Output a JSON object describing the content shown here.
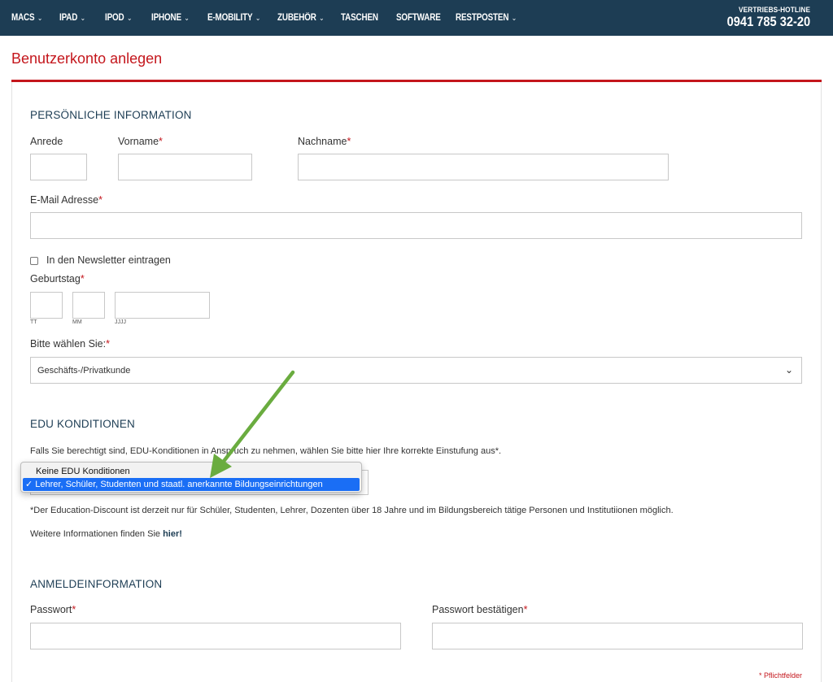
{
  "nav": {
    "items": [
      {
        "label": "MACS",
        "chevron": true
      },
      {
        "label": "IPAD",
        "chevron": true
      },
      {
        "label": "IPOD",
        "chevron": true
      },
      {
        "label": "IPHONE",
        "chevron": true
      },
      {
        "label": "E-MOBILITY",
        "chevron": true
      },
      {
        "label": "ZUBEHÖR",
        "chevron": true
      },
      {
        "label": "TASCHEN",
        "chevron": false
      },
      {
        "label": "SOFTWARE",
        "chevron": false
      },
      {
        "label": "RESTPOSTEN",
        "chevron": true
      }
    ],
    "hotline_label": "VERTRIEBS-HOTLINE",
    "hotline_number": "0941 785 32-20"
  },
  "page": {
    "title": "Benutzerkonto anlegen"
  },
  "personal": {
    "section_title": "PERSÖNLICHE INFORMATION",
    "salutation_label": "Anrede",
    "firstname_label": "Vorname",
    "lastname_label": "Nachname",
    "email_label": "E-Mail Adresse",
    "newsletter_label": "In den Newsletter eintragen",
    "birthday_label": "Geburtstag",
    "day_hint": "TT",
    "month_hint": "MM",
    "year_hint": "JJJJ",
    "customer_type_label": "Bitte wählen Sie:",
    "customer_type_value": "Geschäfts-/Privatkunde",
    "required_mark": "*"
  },
  "edu": {
    "section_title": "EDU KONDITIONEN",
    "intro_text": "Falls Sie berechtigt sind, EDU-Konditionen in Anspruch zu nehmen, wählen Sie bitte hier Ihre korrekte Einstufung aus*.",
    "options": [
      "Keine EDU Konditionen",
      "✓ Lehrer, Schüler, Studenten und staatl. anerkannte Bildungseinrichtungen"
    ],
    "disclaimer": "*Der Education-Discount ist derzeit nur für Schüler, Studenten, Lehrer, Dozenten über 18 Jahre und im Bildungsbereich tätige Personen und Institutiionen möglich.",
    "more_info_prefix": "Weitere Informationen finden Sie ",
    "more_info_link": "hier!"
  },
  "login": {
    "section_title": "ANMELDEINFORMATION",
    "password_label": "Passwort",
    "password_confirm_label": "Passwort bestätigen",
    "required_note": "* Pflichtfelder"
  },
  "colors": {
    "nav_bg": "#1d3d54",
    "accent_red": "#c4161c",
    "annotation_green": "#6aac3f",
    "selection_blue": "#1a6ef5"
  },
  "icons": {
    "nav_chevron": "chevron-down-icon",
    "select_chevron": "chevron-down-icon",
    "annotation": "arrow-annotation-icon"
  }
}
